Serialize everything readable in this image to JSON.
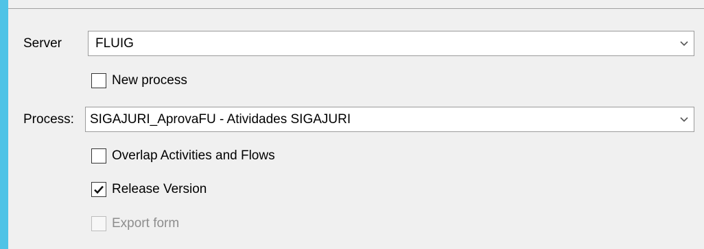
{
  "form": {
    "server_label": "Server",
    "server_value": "FLUIG",
    "new_process_label": "New process",
    "new_process_checked": false,
    "process_label": "Process:",
    "process_value": "SIGAJURI_AprovaFU - Atividades SIGAJURI",
    "overlap_label": "Overlap Activities and Flows",
    "overlap_checked": false,
    "release_label": "Release Version",
    "release_checked": true,
    "export_label": "Export form",
    "export_checked": false,
    "export_enabled": false
  },
  "icons": {
    "dropdown": "chevron-down-icon",
    "check": "checkmark-icon"
  },
  "colors": {
    "accent": "#4fc3e6",
    "background": "#f0f0f0"
  }
}
